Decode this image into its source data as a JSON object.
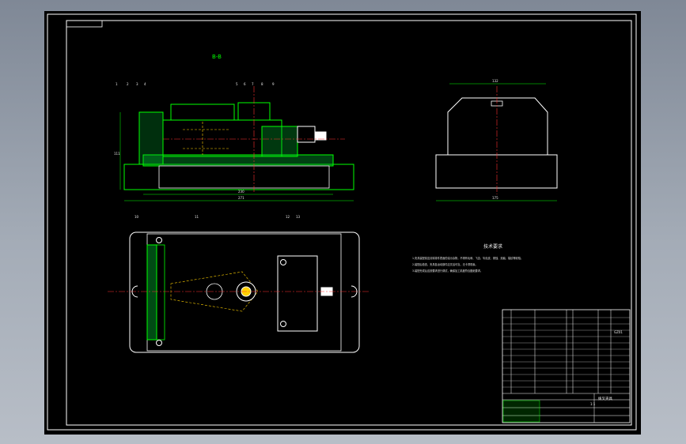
{
  "drawing": {
    "view_label": "B-B",
    "tech_req": {
      "title": "技术要求",
      "lines": [
        "1.夹具装配前应清除零件表面的油污杂物，不得有毛刺、飞边、氧化皮、锈蚀、划痕、裂纹等缺陷。",
        "2.装配后检查，夹具各运动部件应灵活可靠，无卡滞现象。",
        "3.装配完成后应按要求进行调试，确保加工精度符合图纸要求。"
      ]
    },
    "dims": {
      "front_height": "111",
      "front_inner_width": "230",
      "front_overall_width": "271",
      "side_top_width": "132",
      "side_bottom_width": "175"
    },
    "balloons": [
      "1",
      "2",
      "3",
      "4",
      "5",
      "6",
      "7",
      "8",
      "9",
      "10",
      "11",
      "12",
      "13"
    ],
    "title_block": {
      "drawing_no": "GZ01",
      "part_name": "拨叉夹具",
      "scale": "1:1"
    }
  },
  "colors": {
    "sheet": "#000000",
    "outline": "#ffffff",
    "part": "#00ff00",
    "hatch": "#00b050",
    "center": "#ff3030",
    "hidden": "#ffd000",
    "text": "#e8e8e8"
  }
}
